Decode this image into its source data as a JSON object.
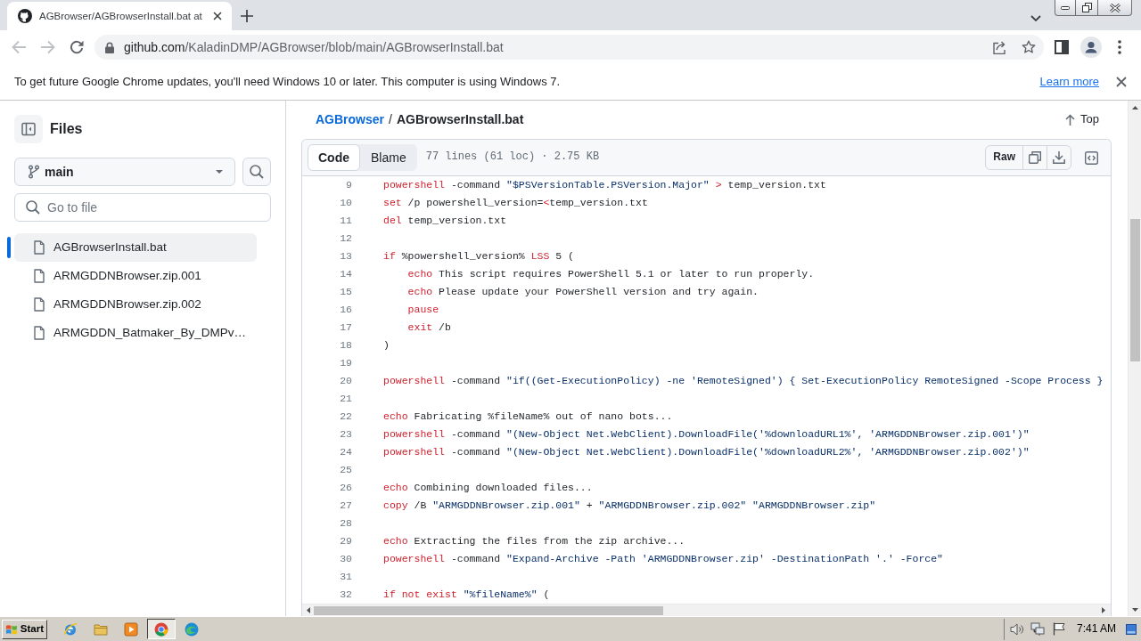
{
  "browser": {
    "tab": {
      "title": "AGBrowser/AGBrowserInstall.bat at",
      "selected": true
    },
    "back": {
      "disabled": true
    },
    "forward": {
      "disabled": true
    },
    "address": {
      "host": "github.com",
      "path": "/KaladinDMP/AGBrowser/blob/main/AGBrowserInstall.bat"
    }
  },
  "infobar": {
    "message": "To get future Google Chrome updates, you'll need Windows 10 or later. This computer is using Windows 7.",
    "link": "Learn more"
  },
  "sidebar": {
    "title": "Files",
    "branch": "main",
    "search": {
      "placeholder": "Go to file"
    },
    "files": [
      {
        "name": "AGBrowserInstall.bat",
        "selected": true
      },
      {
        "name": "ARMGDDNBrowser.zip.001",
        "selected": false
      },
      {
        "name": "ARMGDDNBrowser.zip.002",
        "selected": false
      },
      {
        "name": "ARMGDDN_Batmaker_By_DMPv…",
        "selected": false
      }
    ]
  },
  "file_header": {
    "repo": "AGBrowser",
    "separator": "/",
    "file": "AGBrowserInstall.bat",
    "top_button": "Top"
  },
  "code_toolbar": {
    "tabs": [
      {
        "label": "Code",
        "selected": true
      },
      {
        "label": "Blame",
        "selected": false
      }
    ],
    "info": "77 lines (61 loc) · 2.75 KB",
    "raw_button": "Raw"
  },
  "code": {
    "lines": [
      {
        "number": "9",
        "segments": [
          {
            "kind": "keyword",
            "text": "powershell"
          },
          {
            "kind": "plain",
            "text": " -command "
          },
          {
            "kind": "string",
            "text": "\"$PSVersionTable.PSVersion.Major\" "
          },
          {
            "kind": "keyword",
            "text": ">"
          },
          {
            "kind": "plain",
            "text": " temp_version.txt"
          }
        ]
      },
      {
        "number": "10",
        "segments": [
          {
            "kind": "keyword",
            "text": "set"
          },
          {
            "kind": "plain",
            "text": " /p powershell_version="
          },
          {
            "kind": "keyword",
            "text": "<"
          },
          {
            "kind": "plain",
            "text": "temp_version.txt"
          }
        ]
      },
      {
        "number": "11",
        "segments": [
          {
            "kind": "keyword",
            "text": "del"
          },
          {
            "kind": "plain",
            "text": " temp_version.txt"
          }
        ]
      },
      {
        "number": "12"
      },
      {
        "number": "13",
        "segments": [
          {
            "kind": "keyword",
            "text": "if"
          },
          {
            "kind": "plain",
            "text": " %powershell_version% "
          },
          {
            "kind": "keyword",
            "text": "LSS"
          },
          {
            "kind": "plain",
            "text": " 5 ("
          }
        ]
      },
      {
        "number": "14",
        "segments": [
          {
            "kind": "keyword",
            "text": "    echo"
          },
          {
            "kind": "plain",
            "text": " This script requires PowerShell 5.1 or later to run properly."
          }
        ]
      },
      {
        "number": "15",
        "segments": [
          {
            "kind": "keyword",
            "text": "    echo"
          },
          {
            "kind": "plain",
            "text": " Please update your PowerShell version and try again."
          }
        ]
      },
      {
        "number": "16",
        "segments": [
          {
            "kind": "keyword",
            "text": "    pause"
          }
        ]
      },
      {
        "number": "17",
        "segments": [
          {
            "kind": "keyword",
            "text": "    exit"
          },
          {
            "kind": "plain",
            "text": " /b"
          }
        ]
      },
      {
        "number": "18",
        "segments": [
          {
            "kind": "plain",
            "text": ")"
          }
        ]
      },
      {
        "number": "19"
      },
      {
        "number": "20",
        "segments": [
          {
            "kind": "keyword",
            "text": "powershell"
          },
          {
            "kind": "plain",
            "text": " -command "
          },
          {
            "kind": "string",
            "text": "\"if((Get-ExecutionPolicy) -ne 'RemoteSigned') { Set-ExecutionPolicy RemoteSigned -Scope Process }"
          }
        ]
      },
      {
        "number": "21"
      },
      {
        "number": "22",
        "segments": [
          {
            "kind": "keyword",
            "text": "echo"
          },
          {
            "kind": "plain",
            "text": " Fabricating %fileName% out of nano bots..."
          }
        ]
      },
      {
        "number": "23",
        "segments": [
          {
            "kind": "keyword",
            "text": "powershell"
          },
          {
            "kind": "plain",
            "text": " -command "
          },
          {
            "kind": "string",
            "text": "\"(New-Object Net.WebClient).DownloadFile('%downloadURL1%', 'ARMGDDNBrowser.zip.001')\""
          }
        ]
      },
      {
        "number": "24",
        "segments": [
          {
            "kind": "keyword",
            "text": "powershell"
          },
          {
            "kind": "plain",
            "text": " -command "
          },
          {
            "kind": "string",
            "text": "\"(New-Object Net.WebClient).DownloadFile('%downloadURL2%', 'ARMGDDNBrowser.zip.002')\""
          }
        ]
      },
      {
        "number": "25"
      },
      {
        "number": "26",
        "segments": [
          {
            "kind": "keyword",
            "text": "echo"
          },
          {
            "kind": "plain",
            "text": " Combining downloaded files..."
          }
        ]
      },
      {
        "number": "27",
        "segments": [
          {
            "kind": "keyword",
            "text": "copy"
          },
          {
            "kind": "plain",
            "text": " /B "
          },
          {
            "kind": "string",
            "text": "\"ARMGDDNBrowser.zip.001\""
          },
          {
            "kind": "plain",
            "text": " + "
          },
          {
            "kind": "string",
            "text": "\"ARMGDDNBrowser.zip.002\" "
          },
          {
            "kind": "string",
            "text": "\"ARMGDDNBrowser.zip\""
          }
        ]
      },
      {
        "number": "28"
      },
      {
        "number": "29",
        "segments": [
          {
            "kind": "keyword",
            "text": "echo"
          },
          {
            "kind": "plain",
            "text": " Extracting the files from the zip archive..."
          }
        ]
      },
      {
        "number": "30",
        "segments": [
          {
            "kind": "keyword",
            "text": "powershell"
          },
          {
            "kind": "plain",
            "text": " -command "
          },
          {
            "kind": "string",
            "text": "\"Expand-Archive -Path 'ARMGDDNBrowser.zip' -DestinationPath '.' -Force\""
          }
        ]
      },
      {
        "number": "31"
      },
      {
        "number": "32",
        "segments": [
          {
            "kind": "keyword",
            "text": "if not exist "
          },
          {
            "kind": "string",
            "text": "\"%fileName%\""
          },
          {
            "kind": "plain",
            "text": " ("
          }
        ]
      }
    ]
  },
  "taskbar": {
    "start": "Start",
    "apps": [
      {
        "kind": "ie",
        "selected": false
      },
      {
        "kind": "folder",
        "selected": false
      },
      {
        "kind": "media",
        "selected": false
      },
      {
        "kind": "chrome",
        "selected": true
      },
      {
        "kind": "edge",
        "selected": false
      }
    ],
    "clock": "7:41 AM"
  }
}
